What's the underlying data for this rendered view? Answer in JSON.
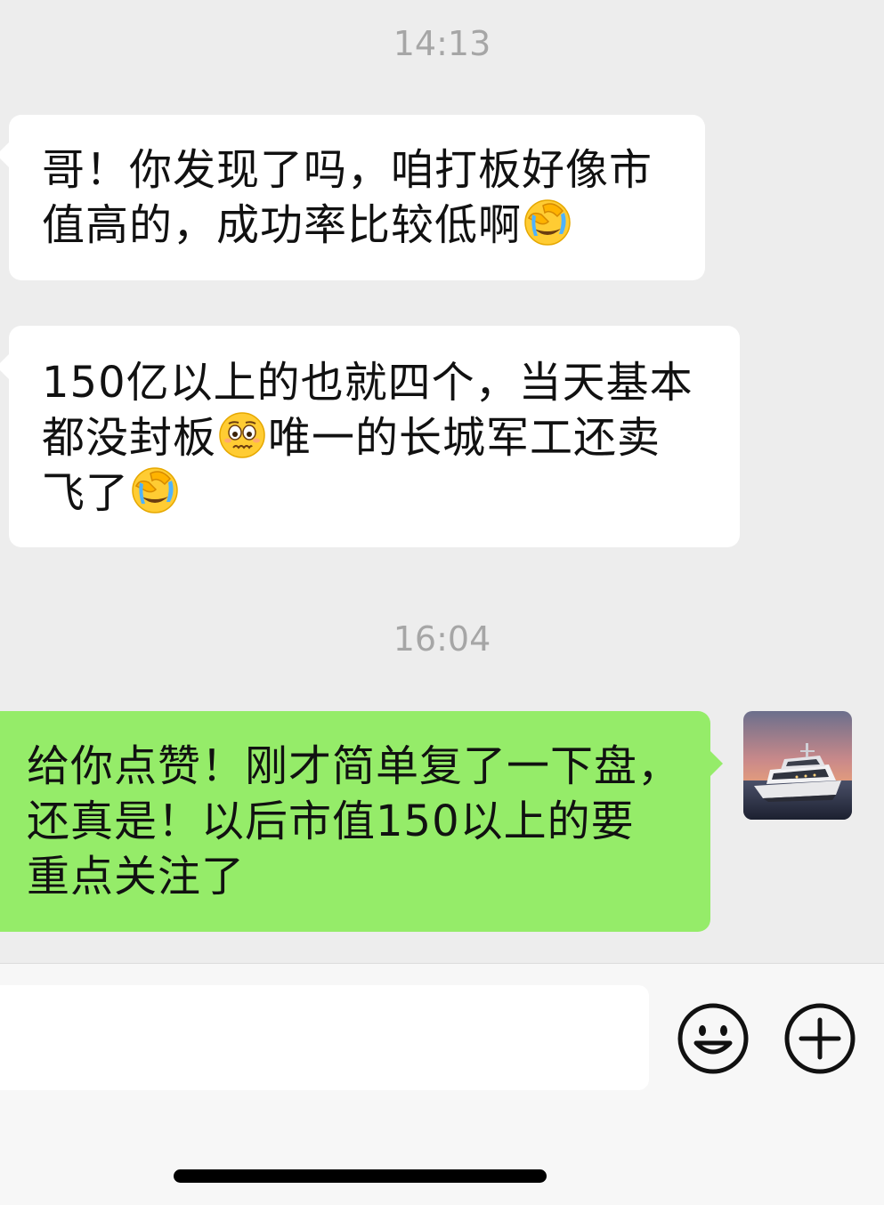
{
  "chat": {
    "timestamps": [
      "14:13",
      "16:04"
    ],
    "messages": [
      {
        "direction": "incoming",
        "lines": [
          {
            "text": "哥！你发现了吗，咱打板好像市",
            "emoji_after": null
          },
          {
            "text": "值高的，成功率比较低啊",
            "emoji_after": "face-palm-crying-emoji"
          }
        ]
      },
      {
        "direction": "incoming",
        "lines": [
          {
            "text_before": "150亿以上的也就四个，当天基本"
          },
          {
            "text_before": "都没封板",
            "emoji": "pleading-worried-emoji",
            "text_after": "唯一的长城军工还卖"
          },
          {
            "text_before": "飞了",
            "emoji": "face-palm-crying-emoji"
          }
        ]
      },
      {
        "direction": "outgoing",
        "lines": [
          {
            "text": "给你点赞！刚才简单复了一下盘，"
          },
          {
            "text": "还真是！以后市值150以上的要"
          },
          {
            "text": "重点关注了"
          }
        ]
      }
    ]
  },
  "input_bar": {
    "emoji_button_icon": "smiley-icon",
    "plus_button_icon": "plus-circle-icon"
  },
  "colors": {
    "background": "#ededed",
    "incoming_bubble": "#ffffff",
    "outgoing_bubble": "#95ec69",
    "timestamp_text": "#a6a6a6"
  }
}
